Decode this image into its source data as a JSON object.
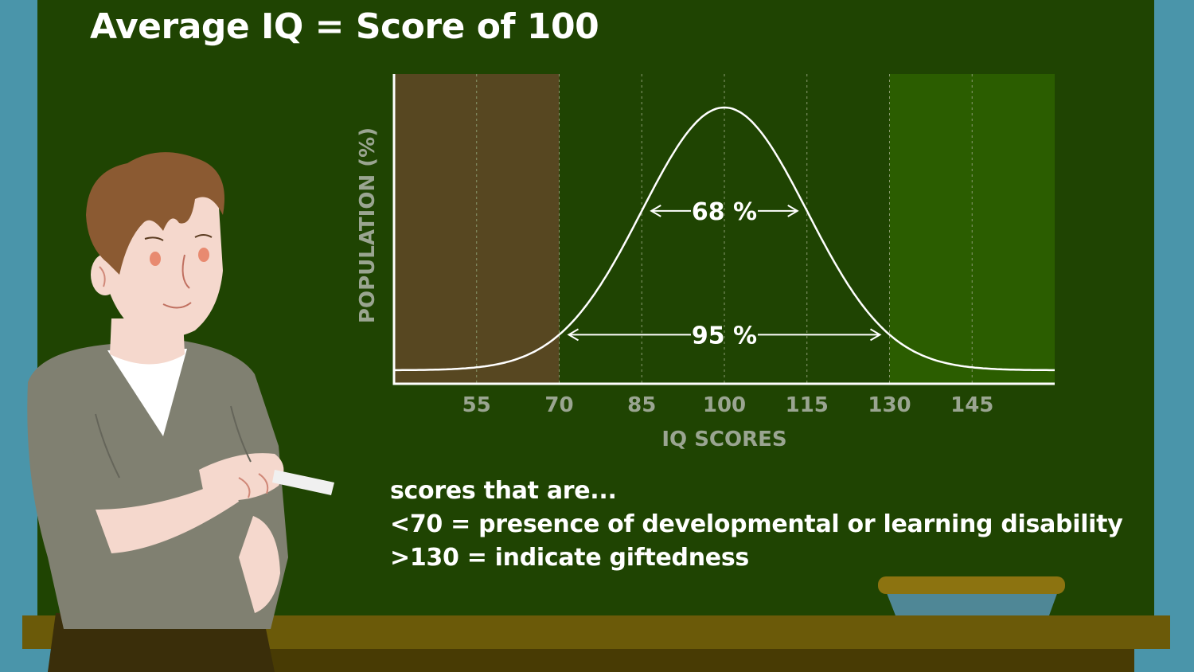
{
  "title": "Average IQ = Score of 100",
  "chart_data": {
    "type": "area",
    "title": "Average IQ = Score of 100",
    "xlabel": "IQ SCORES",
    "ylabel": "POPULATION (%)",
    "xlim": [
      40,
      160
    ],
    "x_ticks": [
      55,
      70,
      85,
      100,
      115,
      130,
      145
    ],
    "x_tick_labels": [
      "55",
      "70",
      "85",
      "100",
      "115",
      "130",
      "145"
    ],
    "distribution": {
      "mean": 100,
      "sd": 15
    },
    "shaded_regions": [
      {
        "x_range": [
          40,
          70
        ],
        "color": "#574721"
      },
      {
        "x_range": [
          130,
          160
        ],
        "color": "#2b5d00"
      }
    ],
    "annotations": [
      {
        "text": "68 %",
        "x_range": [
          85,
          115
        ]
      },
      {
        "text": "95 %",
        "x_range": [
          70,
          130
        ]
      }
    ],
    "grid": "vertical dotted lines at tick values",
    "colors": {
      "curve": "#ffffff",
      "axis": "#ffffff",
      "tick_label": "#9aa591"
    }
  },
  "notes": {
    "line1": "scores that are...",
    "line2": "<70 = presence of developmental or learning disability",
    "line3": ">130 = indicate giftedness"
  }
}
